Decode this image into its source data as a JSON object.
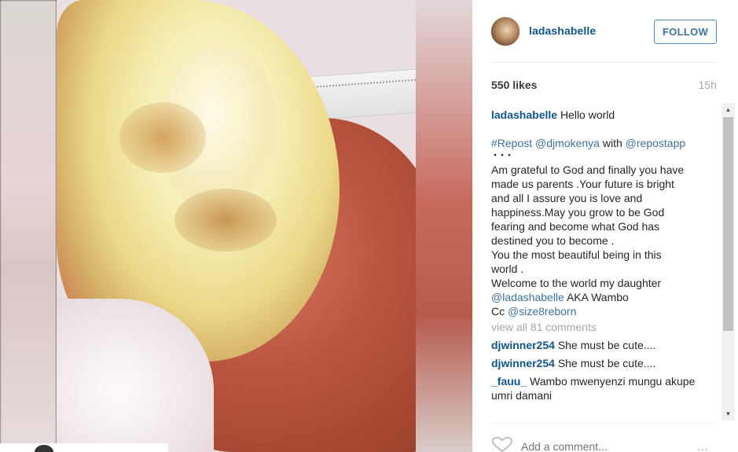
{
  "header": {
    "username": "ladashabelle",
    "follow_label": "FOLLOW"
  },
  "stats": {
    "likes": "550 likes",
    "time": "15h"
  },
  "caption": {
    "username": "ladashabelle",
    "first_line": "Hello world",
    "repost_hashtag": "#Repost",
    "repost_user": "@djmokenya",
    "repost_with": "with",
    "repost_app": "@repostapp",
    "ellipsis": "・・・",
    "lines": [
      "Am grateful to God and finally you have",
      "made us parents .Your future is bright",
      "and all I assure you is love and",
      "happiness.May you grow to be God",
      "fearing and become what God has",
      "destined you to become .",
      "You the most beautiful being in this",
      "world .",
      "Welcome to the world my daughter"
    ],
    "mention_line": {
      "mention": "@ladashabelle",
      "rest": "AKA Wambo"
    },
    "cc_line": {
      "prefix": "Cc",
      "mention": "@size8reborn"
    }
  },
  "view_all": "view all 81 comments",
  "comments": [
    {
      "user": "djwinner254",
      "text": "She must be cute...."
    },
    {
      "user": "djwinner254",
      "text": "She must be cute...."
    },
    {
      "user": "_fauu_",
      "text": "Wambo mwenyenzi mungu akupe umri damani"
    }
  ],
  "footer": {
    "add_comment_placeholder": "Add a comment...",
    "more_label": "..."
  },
  "colors": {
    "username_blue": "#125688",
    "follow_border": "#4f8ac2",
    "muted_gray": "#a5a7aa"
  },
  "icons": {
    "like": "heart-icon",
    "more": "more-options-icon",
    "scroll_up": "scroll-up-arrow-icon",
    "scroll_down": "scroll-down-arrow-icon"
  }
}
